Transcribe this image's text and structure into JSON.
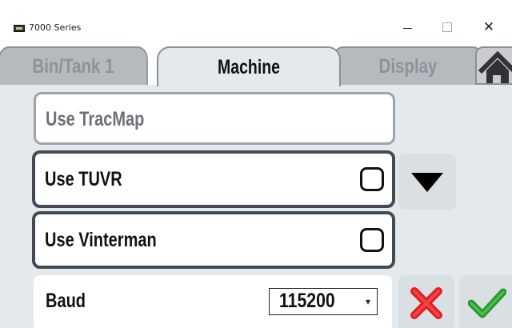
{
  "window": {
    "title": "7000 Series"
  },
  "controls": {
    "minimize": "—",
    "maximize": "□",
    "close": "✕"
  },
  "tabs": [
    {
      "label": "Bin/Tank 1",
      "active": false
    },
    {
      "label": "Machine",
      "active": true
    },
    {
      "label": "Display",
      "active": false
    }
  ],
  "home": {
    "icon": "home-icon"
  },
  "settings": {
    "tracmap": {
      "label": "Use TracMap"
    },
    "tuvr": {
      "label": "Use TUVR",
      "checked": false
    },
    "vinterman": {
      "label": "Use Vinterman",
      "checked": false
    },
    "baud": {
      "label": "Baud",
      "value": "115200"
    }
  },
  "buttons": {
    "down": {
      "icon": "triangle-down-icon"
    },
    "cancel": {
      "icon": "red-x-icon",
      "color": "#e02020"
    },
    "ok": {
      "icon": "green-check-icon",
      "color": "#2a9a2a"
    }
  }
}
